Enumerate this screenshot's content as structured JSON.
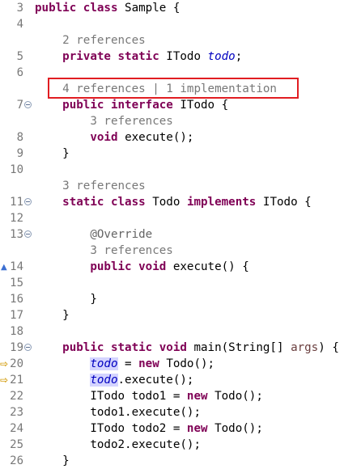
{
  "editor": {
    "lines": [
      {
        "num": "3",
        "fold": false,
        "marker": "",
        "code": [
          [
            "kw",
            "public class "
          ],
          [
            "",
            "Sample {"
          ]
        ]
      },
      {
        "num": "4",
        "fold": false,
        "marker": "",
        "code": []
      },
      {
        "lens": true,
        "parts": [
          [
            "",
            "2 references"
          ]
        ]
      },
      {
        "num": "5",
        "fold": false,
        "marker": "",
        "code": [
          [
            "",
            "    "
          ],
          [
            "kw",
            "private static "
          ],
          [
            "",
            "ITodo "
          ],
          [
            "fld",
            "todo"
          ],
          [
            "",
            ";"
          ]
        ]
      },
      {
        "num": "6",
        "fold": false,
        "marker": "",
        "code": []
      },
      {
        "lens": true,
        "parts": [
          [
            "",
            "4 references"
          ],
          [
            "sep",
            " | "
          ],
          [
            "",
            "1 implementation"
          ]
        ]
      },
      {
        "num": "7",
        "fold": true,
        "marker": "",
        "code": [
          [
            "",
            "    "
          ],
          [
            "kw",
            "public interface "
          ],
          [
            "",
            "ITodo {"
          ]
        ]
      },
      {
        "lens": true,
        "parts": [
          [
            "",
            "3 references"
          ]
        ],
        "indent": 8
      },
      {
        "num": "8",
        "fold": false,
        "marker": "",
        "code": [
          [
            "",
            "        "
          ],
          [
            "kw",
            "void "
          ],
          [
            "",
            "execute();"
          ]
        ]
      },
      {
        "num": "9",
        "fold": false,
        "marker": "",
        "code": [
          [
            "",
            "    }"
          ]
        ]
      },
      {
        "num": "10",
        "fold": false,
        "marker": "",
        "code": []
      },
      {
        "lens": true,
        "parts": [
          [
            "",
            "3 references"
          ]
        ]
      },
      {
        "num": "11",
        "fold": true,
        "marker": "",
        "code": [
          [
            "",
            "    "
          ],
          [
            "kw",
            "static class "
          ],
          [
            "",
            "Todo "
          ],
          [
            "kw",
            "implements "
          ],
          [
            "",
            "ITodo {"
          ]
        ]
      },
      {
        "num": "12",
        "fold": false,
        "marker": "",
        "code": []
      },
      {
        "num": "13",
        "fold": true,
        "marker": "",
        "code": [
          [
            "",
            "        "
          ],
          [
            "ann",
            "@Override"
          ]
        ]
      },
      {
        "lens": true,
        "parts": [
          [
            "",
            "3 references"
          ]
        ],
        "indent": 8
      },
      {
        "num": "14",
        "fold": false,
        "marker": "override",
        "code": [
          [
            "",
            "        "
          ],
          [
            "kw",
            "public void "
          ],
          [
            "",
            "execute() {"
          ]
        ]
      },
      {
        "num": "15",
        "fold": false,
        "marker": "",
        "code": []
      },
      {
        "num": "16",
        "fold": false,
        "marker": "",
        "code": [
          [
            "",
            "        }"
          ]
        ]
      },
      {
        "num": "17",
        "fold": false,
        "marker": "",
        "code": [
          [
            "",
            "    }"
          ]
        ]
      },
      {
        "num": "18",
        "fold": false,
        "marker": "",
        "code": []
      },
      {
        "num": "19",
        "fold": true,
        "marker": "",
        "code": [
          [
            "",
            "    "
          ],
          [
            "kw",
            "public static void "
          ],
          [
            "",
            "main(String[] "
          ],
          [
            "param",
            "args"
          ],
          [
            "",
            ") {"
          ]
        ]
      },
      {
        "num": "20",
        "fold": false,
        "marker": "arrow",
        "code": [
          [
            "",
            "        "
          ],
          [
            "fld hl",
            "todo"
          ],
          [
            "",
            " = "
          ],
          [
            "kw",
            "new "
          ],
          [
            "",
            "Todo();"
          ]
        ]
      },
      {
        "num": "21",
        "fold": false,
        "marker": "arrow",
        "code": [
          [
            "",
            "        "
          ],
          [
            "fld hl",
            "todo"
          ],
          [
            "",
            ".execute();"
          ]
        ]
      },
      {
        "num": "22",
        "fold": false,
        "marker": "",
        "code": [
          [
            "",
            "        ITodo todo1 = "
          ],
          [
            "kw",
            "new "
          ],
          [
            "",
            "Todo();"
          ]
        ]
      },
      {
        "num": "23",
        "fold": false,
        "marker": "",
        "code": [
          [
            "",
            "        todo1.execute();"
          ]
        ]
      },
      {
        "num": "24",
        "fold": false,
        "marker": "",
        "code": [
          [
            "",
            "        ITodo todo2 = "
          ],
          [
            "kw",
            "new "
          ],
          [
            "",
            "Todo();"
          ]
        ]
      },
      {
        "num": "25",
        "fold": false,
        "marker": "",
        "code": [
          [
            "",
            "        todo2.execute();"
          ]
        ]
      },
      {
        "num": "26",
        "fold": false,
        "marker": "",
        "code": [
          [
            "",
            "    }"
          ]
        ]
      }
    ]
  },
  "marker_glyphs": {
    "arrow": "⇨",
    "override": "▲"
  },
  "colors": {
    "keyword": "#7f0055",
    "field": "#0000c0",
    "annotation": "#646464",
    "line_number": "#787878",
    "highlight_box": "#e11d22",
    "occurrence_highlight": "#d4d4ff"
  }
}
